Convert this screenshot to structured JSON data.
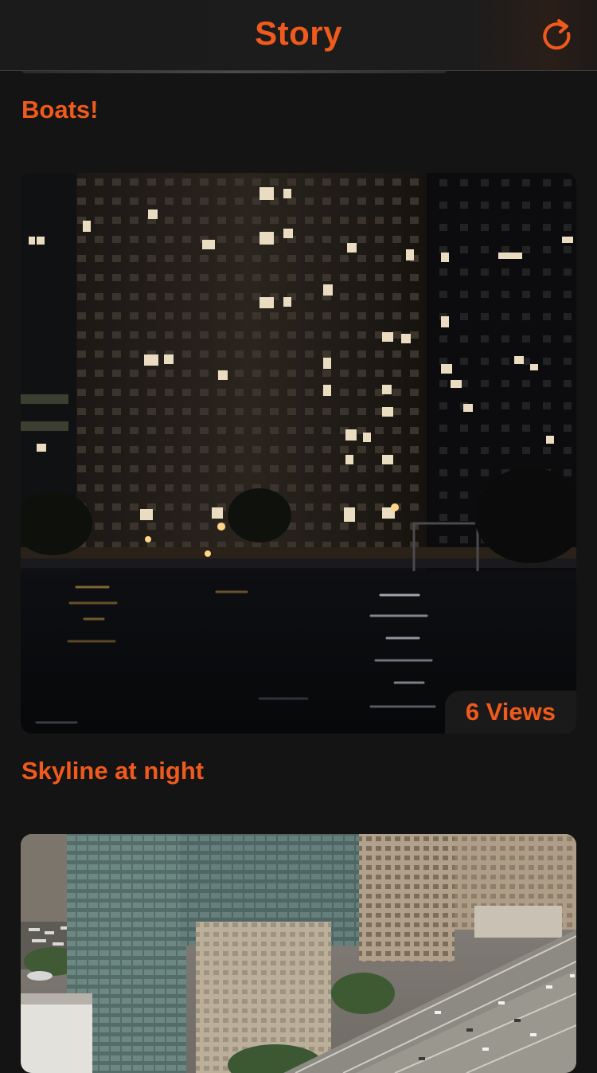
{
  "navbar": {
    "title": "Story",
    "refresh_icon": "refresh-icon"
  },
  "stories": [
    {
      "title": "Boats!",
      "views_label": "6 Views",
      "image": "night-waterfront-photo"
    },
    {
      "title": "Skyline at night",
      "image": "city-highway-photo"
    }
  ],
  "colors": {
    "accent": "#f05a1c",
    "background": "#141414",
    "navbar": "#1b1b1b"
  }
}
